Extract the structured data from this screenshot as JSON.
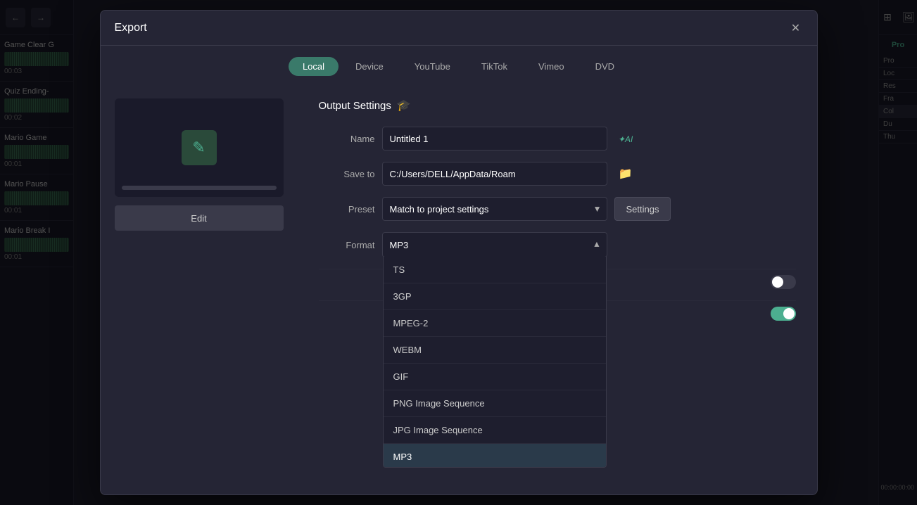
{
  "app": {
    "title": "Export"
  },
  "tabs": {
    "items": [
      "Local",
      "Device",
      "YouTube",
      "TikTok",
      "Vimeo",
      "DVD"
    ],
    "active": "Local"
  },
  "preview": {
    "edit_label": "Edit"
  },
  "output_settings": {
    "section_title": "Output Settings",
    "name_label": "Name",
    "name_value": "Untitled 1",
    "save_to_label": "Save to",
    "save_to_value": "C:/Users/DELL/AppData/Roam",
    "preset_label": "Preset",
    "preset_value": "Match to project settings",
    "settings_label": "Settings",
    "format_label": "Format",
    "format_value": "MP3"
  },
  "format_options": [
    {
      "label": "TS",
      "value": "TS"
    },
    {
      "label": "3GP",
      "value": "3GP"
    },
    {
      "label": "MPEG-2",
      "value": "MPEG-2"
    },
    {
      "label": "WEBM",
      "value": "WEBM"
    },
    {
      "label": "GIF",
      "value": "GIF"
    },
    {
      "label": "PNG Image Sequence",
      "value": "PNG Image Sequence"
    },
    {
      "label": "JPG Image Sequence",
      "value": "JPG Image Sequence"
    },
    {
      "label": "MP3",
      "value": "MP3",
      "selected": true
    }
  ],
  "toggles": [
    {
      "label": "",
      "state": "off"
    },
    {
      "label": "",
      "state": "on"
    }
  ],
  "sidebar": {
    "items": [
      {
        "title": "Game Clear G",
        "time": "00:03"
      },
      {
        "title": "Quiz Ending-",
        "time": "00:02"
      },
      {
        "title": "Mario Game",
        "time": "00:01"
      },
      {
        "title": "Mario Pause",
        "time": "00:01"
      },
      {
        "title": "Mario Break I",
        "time": "00:01"
      }
    ]
  },
  "right_panel": {
    "label": "Pro",
    "properties": [
      {
        "key": "Pro",
        "value": ""
      },
      {
        "key": "Loc",
        "value": ""
      },
      {
        "key": "Res",
        "value": ""
      },
      {
        "key": "Fra",
        "value": ""
      },
      {
        "key": "Col",
        "value": ""
      },
      {
        "key": "Du",
        "value": ""
      },
      {
        "key": "Thu",
        "value": ""
      }
    ],
    "time_code": "00:00:00:00"
  }
}
